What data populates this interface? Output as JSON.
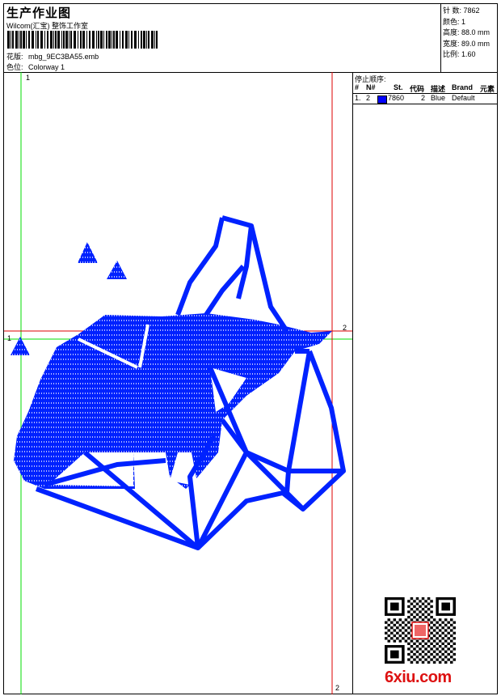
{
  "header": {
    "title": "生产作业图",
    "company": "Wilcom(汇宝) 整饰工作室",
    "design_label": "花版:",
    "design_file": "mbg_9EC3BA55.emb",
    "colorway_label": "色位:",
    "colorway": "Colorway 1"
  },
  "stats": {
    "stitches_label": "针 数:",
    "stitches": "7862",
    "colors_label": "颜色:",
    "colors": "1",
    "height_label": "高度:",
    "height": "88.0 mm",
    "width_label": "宽度:",
    "width": "89.0 mm",
    "scale_label": "比例:",
    "scale": "1.60"
  },
  "stop_sequence": {
    "title": "停止顺序:",
    "columns": [
      "#",
      "N#",
      "St.",
      "代码",
      "描述",
      "Brand",
      "元素"
    ],
    "rows": [
      {
        "index": "1.",
        "needle": "2",
        "stitches": "7860",
        "code": "2",
        "description": "Blue",
        "brand": "Default",
        "color": "#0000ff"
      }
    ]
  },
  "axes": {
    "v1": "1",
    "h1": "1",
    "h2": "2",
    "v2": "2"
  },
  "colors": {
    "stitch": "#0022ff",
    "green_guide": "#00dd00",
    "red_guide": "#dd0000"
  },
  "watermark": "6xiu.com"
}
